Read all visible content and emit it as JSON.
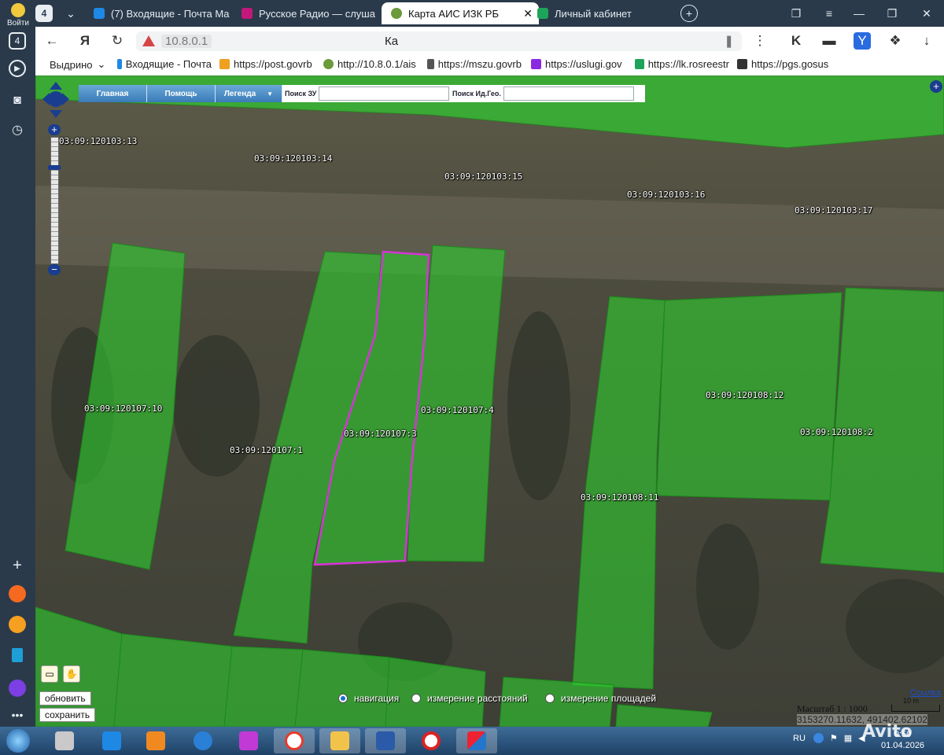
{
  "browser": {
    "login_label": "Войти",
    "tab_counter": "4",
    "tabs": [
      {
        "title": "(7) Входящие - Почта Ma",
        "favicon_color": "#1e88e5"
      },
      {
        "title": "Русское Радио — слушат",
        "favicon_color": "#c2187a"
      },
      {
        "title": "Карта АИС ИЗК РБ",
        "favicon_color": "#6a9a3a"
      },
      {
        "title": "Личный кабинет",
        "favicon_color": "#1ea35a"
      }
    ],
    "url_host": "10.8.0.1",
    "page_title_partial": "Ка",
    "bookmarks": [
      {
        "label": "Выдрино",
        "has_chevron": true
      },
      {
        "label": "Входящие - Почта",
        "icon_color": "#1e88e5"
      },
      {
        "label": "https://post.govrb",
        "icon_color": "#f0a020"
      },
      {
        "label": "http://10.8.0.1/ais",
        "icon_color": "#6a9a3a"
      },
      {
        "label": "https://mszu.govrb",
        "icon_color": "#555555"
      },
      {
        "label": "https://uslugi.gov",
        "icon_color": "#8a2be2"
      },
      {
        "label": "https://lk.rosreestr",
        "icon_color": "#1ea35a"
      },
      {
        "label": "https://pgs.gosus",
        "icon_color": "#333333"
      }
    ]
  },
  "map_toolbar": {
    "home": "Главная",
    "help": "Помощь",
    "legend": "Легенда",
    "search_parcel_label": "Поиск ЗУ",
    "search_geo_label": "Поиск Ид.Гео.",
    "search_parcel_value": "",
    "search_geo_value": ""
  },
  "parcels": [
    {
      "id": "03:09:120103:13"
    },
    {
      "id": "03:09:120103:14"
    },
    {
      "id": "03:09:120103:15"
    },
    {
      "id": "03:09:120103:16"
    },
    {
      "id": "03:09:120103:17"
    },
    {
      "id": "03:09:120107:10"
    },
    {
      "id": "03:09:120107:1"
    },
    {
      "id": "03:09:120107:3"
    },
    {
      "id": "03:09:120107:4"
    },
    {
      "id": "03:09:120108:11"
    },
    {
      "id": "03:09:120108:12"
    },
    {
      "id": "03:09:120108:2"
    }
  ],
  "selected_parcel": "03:09:120107:3",
  "colors": {
    "parcel_fill": "#2ecc2e",
    "selection_outline": "#d633d6"
  },
  "controls": {
    "refresh": "обновить",
    "save": "сохранить",
    "modes": [
      {
        "label": "навигация",
        "checked": true
      },
      {
        "label": "измерение расстояний",
        "checked": false
      },
      {
        "label": "измерение площадей",
        "checked": false
      }
    ],
    "scale": "Масштаб 1 : 1000",
    "scale_bar": "10 m",
    "coords": "3153270.11632, 491402.62102",
    "link": "Ссылка"
  },
  "taskbar": {
    "lang": "RU",
    "time": "9:50",
    "date": "01.04.2026"
  },
  "watermark": "Avito"
}
